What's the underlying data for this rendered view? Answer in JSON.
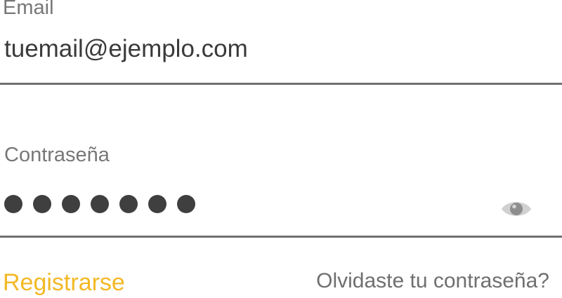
{
  "email": {
    "label": "Email",
    "value": "tuemail@ejemplo.com"
  },
  "password": {
    "label": "Contraseña",
    "masked_length": 7,
    "toggle_icon": "eye-icon"
  },
  "links": {
    "register": "Registrarse",
    "forgot": "Olvidaste tu contraseña?"
  },
  "colors": {
    "accent": "#f4b826",
    "label": "#777777",
    "text": "#3a3a3a",
    "underline": "#707070",
    "icon": "#d0d0d0"
  }
}
